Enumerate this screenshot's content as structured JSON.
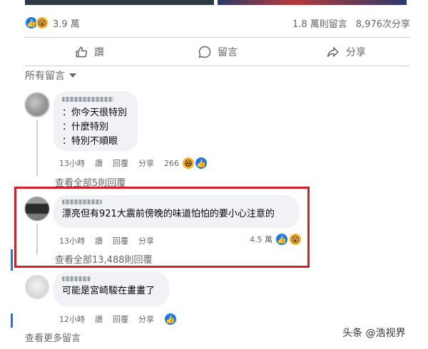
{
  "post": {
    "reaction_count": "3.9 萬",
    "comment_count": "1.8 萬則留言",
    "share_count": "8,976次分享"
  },
  "actions": {
    "like": "讚",
    "comment": "留言",
    "share": "分享"
  },
  "sort": {
    "label": "所有留言"
  },
  "comments": [
    {
      "lines": [
        "：你今天很特別",
        "：什麼特別",
        "：特別不順眼"
      ],
      "time": "13小時",
      "like": "讚",
      "reply": "回覆",
      "share": "分享",
      "reaction_count": "266",
      "view_replies": "查看全部5則回覆"
    },
    {
      "lines": [
        "漂亮但有921大震前傍晚的味道怕怕的要小心注意的"
      ],
      "time": "13小時",
      "like": "讚",
      "reply": "回覆",
      "share": "分享",
      "reaction_count": "4.5 萬",
      "view_replies": "查看全部13,488則回覆"
    },
    {
      "lines": [
        "可能是宮崎駿在畫畫了"
      ],
      "time": "12小時",
      "like": "讚",
      "reply": "回覆",
      "share": "分享"
    }
  ],
  "more_comments": "查看更多留言",
  "watermark": {
    "text": "头条 @浩视界"
  },
  "colors": {
    "accent": "#1877f2",
    "highlight": "#d2202a"
  }
}
